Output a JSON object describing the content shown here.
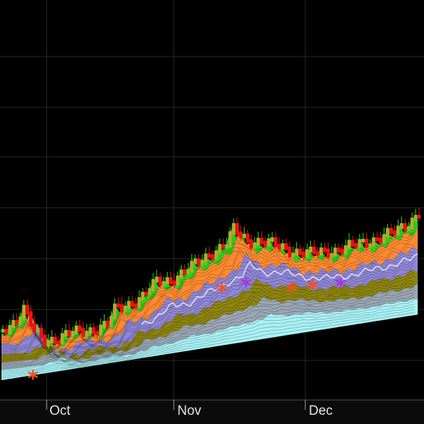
{
  "chart_data": {
    "type": "candlestick",
    "x_tick_labels": [
      "Oct",
      "Nov",
      "Dec"
    ],
    "grid": true,
    "legend": "none",
    "colors": {
      "background": "#000000",
      "grid": "#2a2a2a",
      "axis_panel": "#0b0b0b",
      "up_candle_outline": "#33dd22",
      "down_candle_body": "#ee1111",
      "short_ma_fan": "#ff8a30",
      "mid_ma_fan": "#8f86d6",
      "long_ma_fan_upper": "#8d8410",
      "long_ma_fan_lower": "#9aa6b4",
      "longest_ma_fan": "#a9f1f4",
      "center_line": "#ffffff",
      "marker_orange": "#ff4a1a",
      "marker_purple": "#aa33dd"
    },
    "markers": [
      {
        "symbol": "*",
        "color": "orange",
        "date_index": 9
      },
      {
        "symbol": "*",
        "color": "orange",
        "date_index": 63
      },
      {
        "symbol": "*",
        "color": "purple",
        "date_index": 70
      },
      {
        "symbol": "*",
        "color": "orange",
        "date_index": 83
      },
      {
        "symbol": "*",
        "color": "orange",
        "date_index": 89
      },
      {
        "symbol": "*",
        "color": "purple",
        "date_index": 97
      }
    ]
  }
}
